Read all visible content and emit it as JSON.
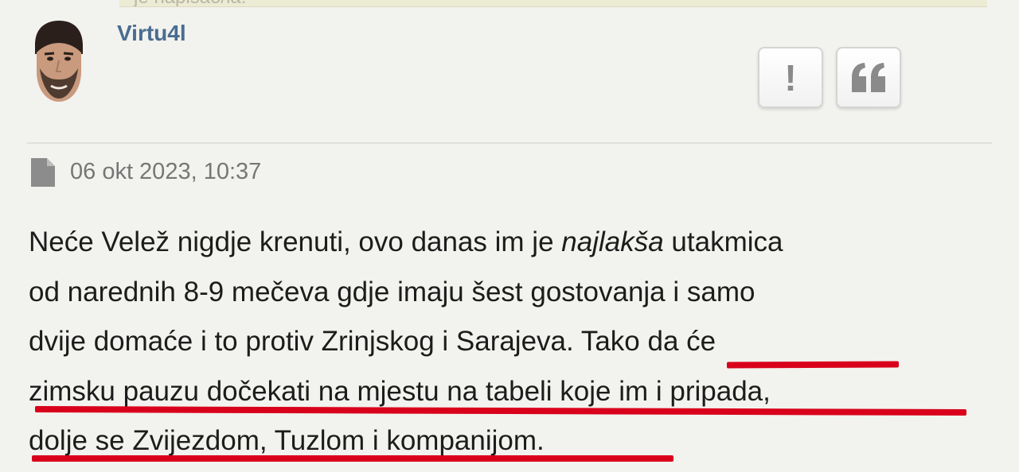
{
  "background_strip": {
    "text": "je napisao/la:"
  },
  "post": {
    "username": "Virtu4l",
    "date": "06 okt 2023, 10:37",
    "actions": {
      "report_label": "!",
      "quote_icon": "quote-icon"
    },
    "icons": {
      "avatar": "avatar-photo",
      "date": "document-icon"
    },
    "body": {
      "line1_before": "Neće Velež nigdje krenuti, ovo danas im je ",
      "line1_emphasis": "najlakša",
      "line1_after": " utakmica",
      "line2": "od narednih 8-9 mečeva gdje imaju šest gostovanja i samo",
      "line3_before": "dvije domaće i to protiv Zrinjskog i Sarajeva. ",
      "line3_marked": "Tako da će",
      "line4": "zimsku pauzu dočekati na mjestu na tabeli koje im i pripada,",
      "line5_marked": "dolje se Zvijezdom, Tuzlom i kompanijom",
      "line5_after": "."
    }
  },
  "colors": {
    "username": "#496c90",
    "highlight_underline": "#d9001b",
    "text": "#1c1c1c",
    "meta": "#767676",
    "background": "#f2f2ee"
  }
}
